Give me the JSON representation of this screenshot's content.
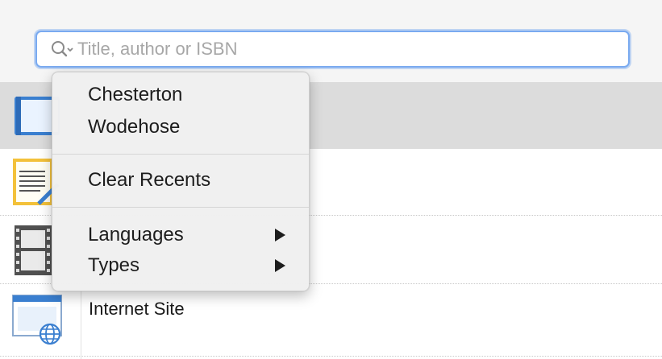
{
  "search": {
    "placeholder": "Title, author or ISBN",
    "value": ""
  },
  "menu": {
    "recents": [
      "Chesterton",
      "Wodehose"
    ],
    "clear_recents": "Clear Recents",
    "languages": "Languages",
    "types": "Types"
  },
  "rows": {
    "internet_site": "Internet Site"
  },
  "icons": {
    "search": "magnifier-with-dropdown-icon",
    "book": "book-icon",
    "notepad": "notepad-icon",
    "film": "film-strip-icon",
    "web": "web-page-globe-icon",
    "submenu": "submenu-arrow-icon"
  },
  "colors": {
    "focus_ring": "#7aaaf0",
    "header_row": "#dcdcdc",
    "menu_bg": "#f0f0f0",
    "icon_blue": "#3a7fd0"
  }
}
